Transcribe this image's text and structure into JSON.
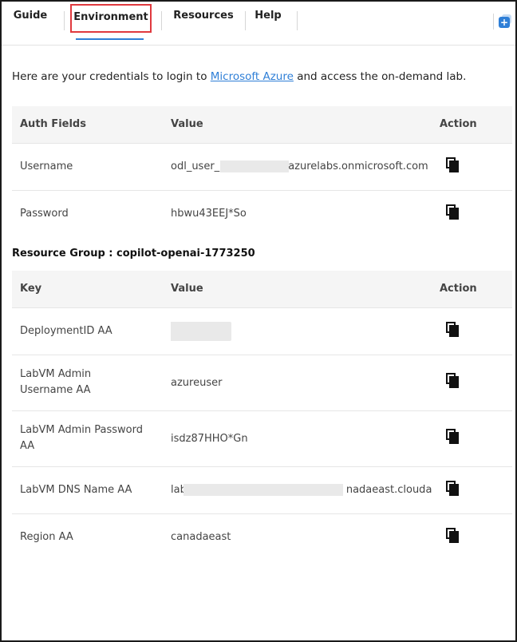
{
  "tabs": {
    "guide": "Guide",
    "environment": "Environment",
    "resources": "Resources",
    "help": "Help"
  },
  "intro": {
    "before": "Here are your credentials to login to ",
    "link": "Microsoft Azure",
    "after": " and access the on-demand lab."
  },
  "credentials": {
    "headers": {
      "field": "Auth Fields",
      "value": "Value",
      "action": "Action"
    },
    "rows": [
      {
        "field": "Username",
        "value_prefix": "odl_user_",
        "value_suffix": "azurelabs.onmicrosoft.com"
      },
      {
        "field": "Password",
        "value": "hbwu43EEJ*So"
      }
    ]
  },
  "resource_group": {
    "label": "Resource Group : copilot-openai-1773250",
    "headers": {
      "key": "Key",
      "value": "Value",
      "action": "Action"
    },
    "rows": [
      {
        "key": "DeploymentID AA",
        "value": ""
      },
      {
        "key": "LabVM Admin Username AA",
        "value": "azureuser"
      },
      {
        "key": "LabVM Admin Password AA",
        "value": "isdz87HHO*Gn"
      },
      {
        "key": "LabVM DNS Name AA",
        "value_prefix": "lab",
        "value_suffix": "nadaeast.clouda"
      },
      {
        "key": "Region AA",
        "value": "canadaeast"
      }
    ]
  },
  "icons": {
    "copy": "copy-icon",
    "add": "add-icon"
  },
  "colors": {
    "accent": "#2f7fd7",
    "highlight_border": "#e0393e"
  }
}
